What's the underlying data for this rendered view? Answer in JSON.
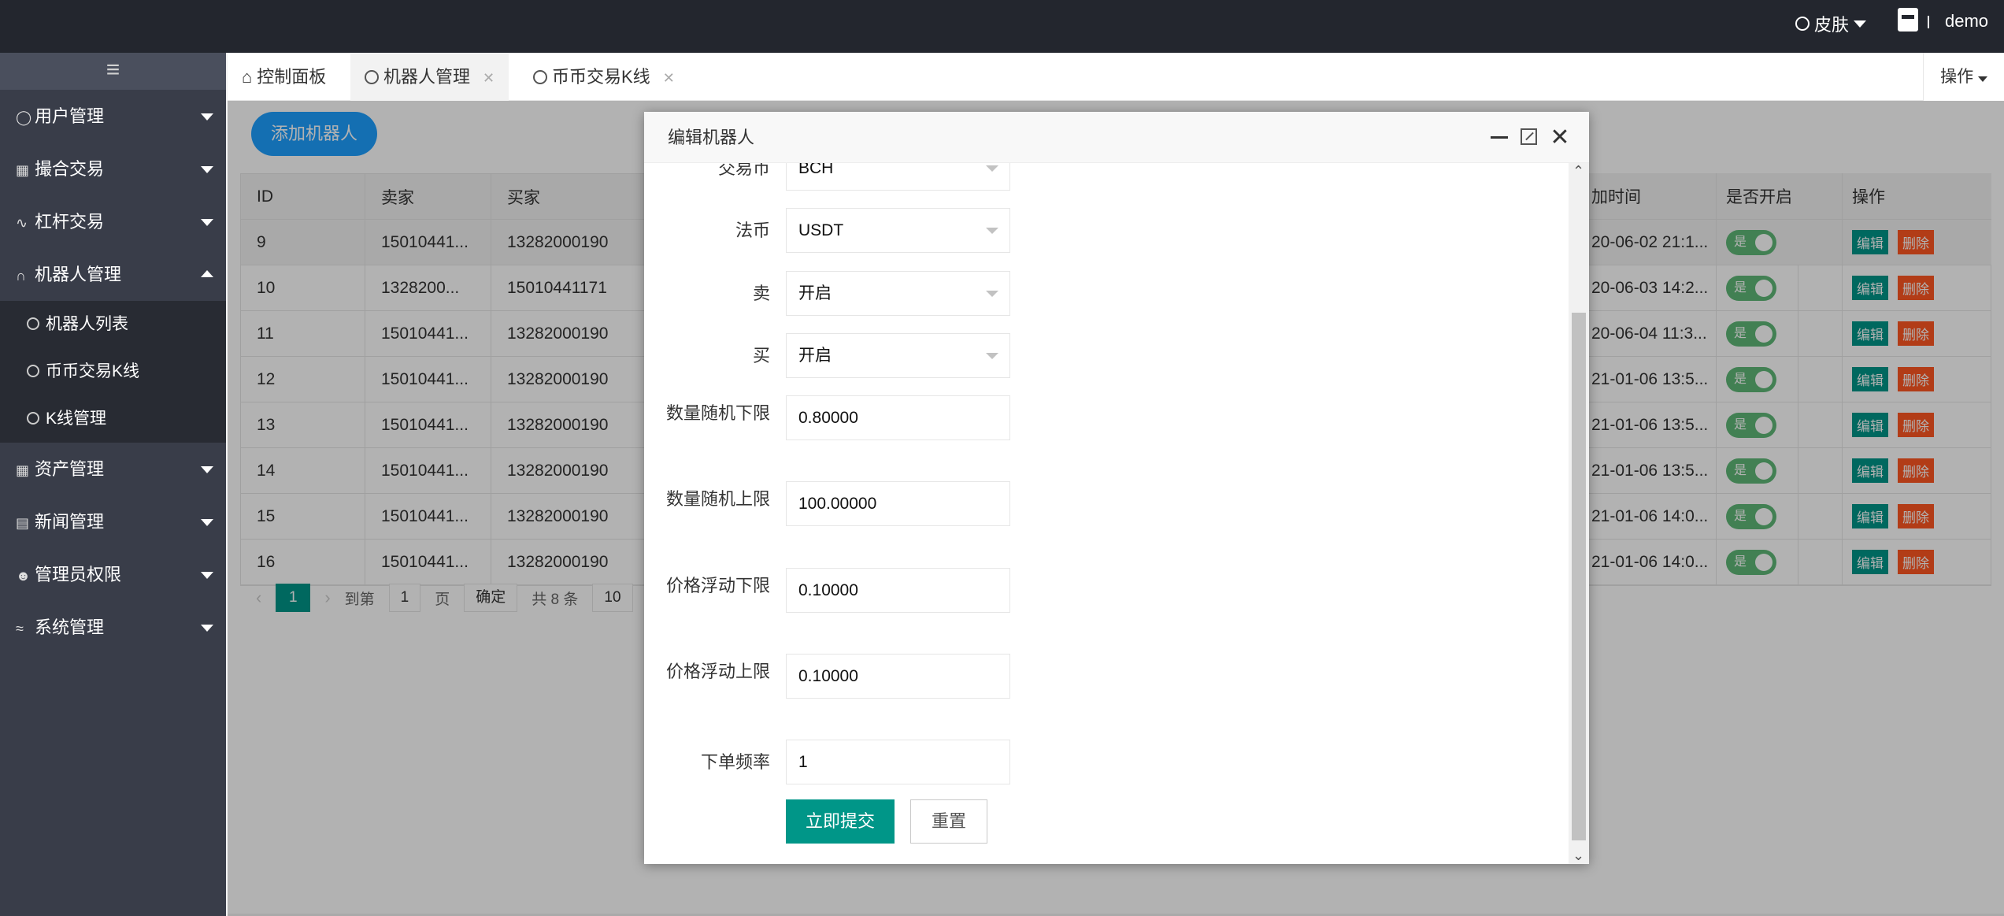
{
  "header": {
    "skin_label": "皮肤",
    "user_name": "demo"
  },
  "sidebar": {
    "toggle_icon": "≡",
    "items": [
      {
        "label": "用户管理",
        "icon": "user-icon"
      },
      {
        "label": "撮合交易",
        "icon": "grid-icon"
      },
      {
        "label": "杠杆交易",
        "icon": "chart-line-icon"
      },
      {
        "label": "机器人管理",
        "icon": "headset-icon",
        "open": true
      },
      {
        "label": "资产管理",
        "icon": "table-icon"
      },
      {
        "label": "新闻管理",
        "icon": "document-icon"
      },
      {
        "label": "管理员权限",
        "icon": "users-icon"
      },
      {
        "label": "系统管理",
        "icon": "tools-icon"
      }
    ],
    "sub_items": [
      "机器人列表",
      "币币交易K线",
      "K线管理"
    ]
  },
  "tabs": [
    {
      "label": "控制面板",
      "icon": "home-icon"
    },
    {
      "label": "机器人管理",
      "icon": "clock-icon",
      "active": true
    },
    {
      "label": "币币交易K线",
      "icon": "clock-icon"
    }
  ],
  "ops_label": "操作",
  "main": {
    "add_button": "添加机器人",
    "columns": [
      "ID",
      "卖家",
      "买家",
      "加时间",
      "是否开启",
      "操作"
    ],
    "rows": [
      {
        "id": "9",
        "seller": "15010441...",
        "buyer": "13282000190",
        "time": "20-06-02 21:1...",
        "on": "是"
      },
      {
        "id": "10",
        "seller": "1328200...",
        "buyer": "15010441171",
        "time": "20-06-03 14:2...",
        "on": "是"
      },
      {
        "id": "11",
        "seller": "15010441...",
        "buyer": "13282000190",
        "time": "20-06-04 11:3...",
        "on": "是"
      },
      {
        "id": "12",
        "seller": "15010441...",
        "buyer": "13282000190",
        "time": "21-01-06 13:5...",
        "on": "是"
      },
      {
        "id": "13",
        "seller": "15010441...",
        "buyer": "13282000190",
        "time": "21-01-06 13:5...",
        "on": "是"
      },
      {
        "id": "14",
        "seller": "15010441...",
        "buyer": "13282000190",
        "time": "21-01-06 13:5...",
        "on": "是"
      },
      {
        "id": "15",
        "seller": "15010441...",
        "buyer": "13282000190",
        "time": "21-01-06 14:0...",
        "on": "是"
      },
      {
        "id": "16",
        "seller": "15010441...",
        "buyer": "13282000190",
        "time": "21-01-06 14:0...",
        "on": "是"
      }
    ],
    "edit_label": "编辑",
    "delete_label": "删除",
    "pager": {
      "current": "1",
      "goto_label": "到第",
      "goto_value": "1",
      "page_label": "页",
      "confirm": "确定",
      "total": "共 8 条",
      "per_page": "10"
    }
  },
  "modal": {
    "title": "编辑机器人",
    "fields": [
      {
        "label": "交易币",
        "value": "BCH",
        "select": true
      },
      {
        "label": "法币",
        "value": "USDT",
        "select": true
      },
      {
        "label": "卖",
        "value": "开启",
        "select": true
      },
      {
        "label": "买",
        "value": "开启",
        "select": true
      },
      {
        "label": "数量随机下限",
        "value": "0.80000"
      },
      {
        "label": "数量随机上限",
        "value": "100.00000"
      },
      {
        "label": "价格浮动下限",
        "value": "0.10000"
      },
      {
        "label": "价格浮动上限",
        "value": "0.10000"
      },
      {
        "label": "下单频率",
        "value": "1"
      }
    ],
    "submit": "立即提交",
    "reset": "重置"
  }
}
